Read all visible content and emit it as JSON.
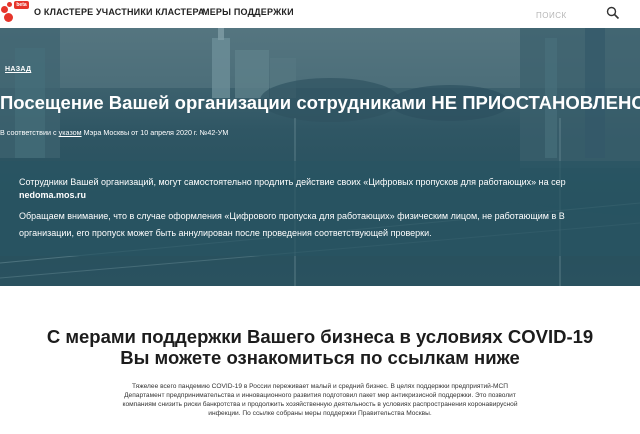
{
  "header": {
    "logo_badge": "beta",
    "nav": [
      "О КЛАСТЕРЕ",
      "УЧАСТНИКИ КЛАСТЕРА",
      "МЕРЫ ПОДДЕРЖКИ"
    ],
    "search_placeholder": "ПОИСК"
  },
  "hero": {
    "back_label": "НАЗАД",
    "title": "Посещение Вашей организации сотрудниками НЕ ПРИОСТАНОВЛЕНО",
    "decree_prefix": "В соответствии с ",
    "decree_link": "указом",
    "decree_suffix": " Мэра Москвы от 10 апреля 2020 г. №42-УМ",
    "info_line1": "Сотрудники Вашей организаций, могут самостоятельно продлить действие своих «Цифровых пропусков для работающих» на сер",
    "info_link": "nedoma.mos.ru",
    "info_line2": "Обращаем внимание, что в случае оформления «Цифрового пропуска для работающих» физическим лицом, не работающим в В",
    "info_line3": "организации, его пропуск может быть аннулирован после проведения соответствующей проверки."
  },
  "support": {
    "heading_line1": "С мерами поддержки Вашего бизнеса в условиях COVID-19",
    "heading_line2": "Вы можете ознакомиться по ссылкам ниже",
    "intro_lines": [
      "Тяжелее всего пандемию COVID-19 в России переживает малый и средний бизнес. В целях поддержки предприятий-МСП",
      "Департамент предпринимательства и инновационного развития подготовил пакет мер антикризисной поддержки. Это позволит",
      "компаниям снизить риски банкротства и продолжить хозяйственную деятельность в условиях распространения коронавирусной",
      "инфекции. По ссылке собраны меры поддержки Правительства Москвы."
    ]
  },
  "colors": {
    "accent": "#e6352b",
    "hero_overlay": "#2b5562"
  }
}
